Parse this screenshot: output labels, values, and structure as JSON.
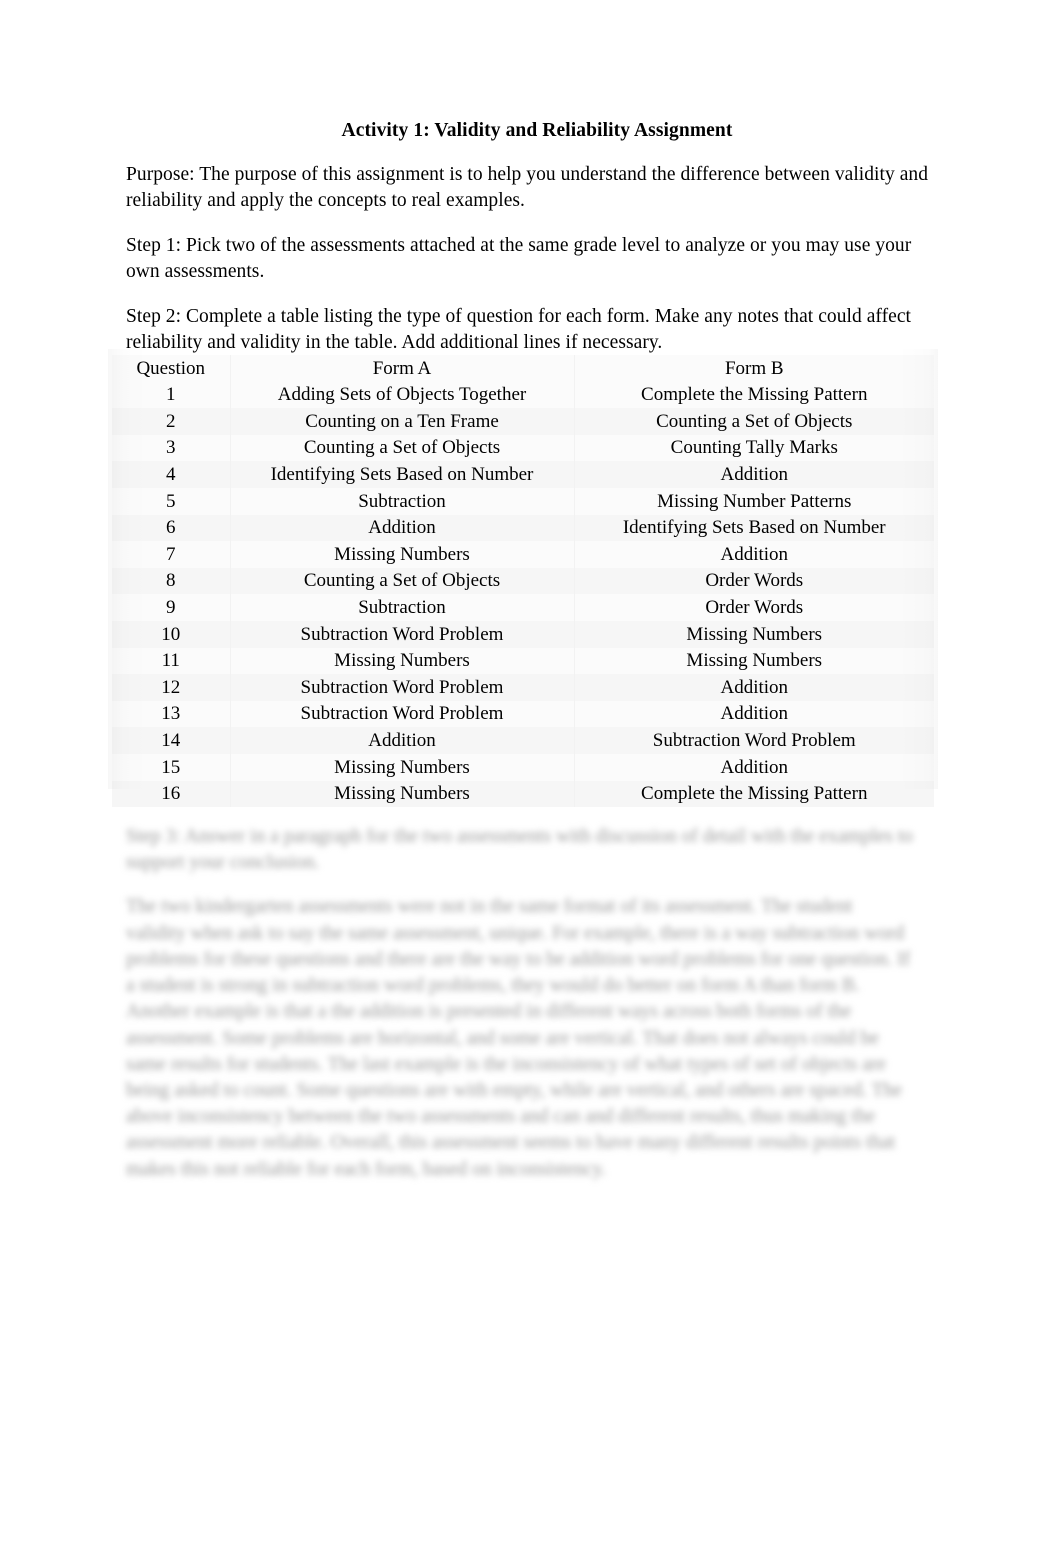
{
  "document": {
    "title": "Activity 1: Validity and Reliability Assignment",
    "paragraphs": [
      {
        "id": "purpose",
        "label": "Purpose:",
        "text": "Purpose:  The purpose of this assignment is to help you understand the difference between validity and reliability and apply the concepts to real examples."
      },
      {
        "id": "step1",
        "label": "Step 1:",
        "text": "Step 1:  Pick two of the assessments attached at the same grade level to analyze or you may use your own assessments."
      },
      {
        "id": "step2",
        "label": "Step 2:",
        "text": "Step 2:  Complete a table listing the type of question for each form.  Make any notes that could affect reliability and validity in the table.  Add additional lines if necessary."
      }
    ]
  },
  "table": {
    "headers": [
      "Question",
      "Form A",
      "Form B"
    ],
    "rows": [
      [
        "1",
        "Adding Sets of Objects Together",
        "Complete the Missing Pattern"
      ],
      [
        "2",
        "Counting on a Ten Frame",
        "Counting a Set of Objects"
      ],
      [
        "3",
        "Counting a Set of Objects",
        "Counting Tally Marks"
      ],
      [
        "4",
        "Identifying Sets Based on Number",
        "Addition"
      ],
      [
        "5",
        "Subtraction",
        "Missing Number Patterns"
      ],
      [
        "6",
        "Addition",
        "Identifying Sets Based on Number"
      ],
      [
        "7",
        "Missing Numbers",
        "Addition"
      ],
      [
        "8",
        "Counting a Set of Objects",
        "Order Words"
      ],
      [
        "9",
        "Subtraction",
        "Order Words"
      ],
      [
        "10",
        "Subtraction Word Problem",
        "Missing Numbers"
      ],
      [
        "11",
        "Missing Numbers",
        "Missing Numbers"
      ],
      [
        "12",
        "Subtraction Word Problem",
        "Addition"
      ],
      [
        "13",
        "Subtraction Word Problem",
        "Addition"
      ],
      [
        "14",
        "Addition",
        "Subtraction Word Problem"
      ],
      [
        "15",
        "Missing Numbers",
        "Addition"
      ],
      [
        "16",
        "Missing Numbers",
        "Complete the Missing Pattern"
      ]
    ]
  },
  "obscured": {
    "note": "illegible-blurred-text",
    "paragraphs": [
      "Step 3:  Answer in a paragraph for the two assessments with discussion of detail with the examples to support your conclusion.",
      "The two kindergarten assessments were not in the same format of its assessment. The student validity when ask to say the same assessment, unique. For example, there is a way subtraction word problems for these questions and there are the way to be addition word problems for one question. If a student is strong in subtraction word problems, they would do better on form A than form B. Another example is that a the addition is presented in different ways across both forms of the assessment. Some problems are horizontal, and some are vertical. That does not always could be same results for students. The last example is the inconsistency of what types of set of objects are being asked to count. Some questions are with empty, while are vertical, and others are spaced. The above inconsistency between the two assessments and can and different results, thus making the assessment more reliable. Overall, this assessment seems to have many different results points that makes this not reliable for each form, based on inconsistency."
    ]
  }
}
